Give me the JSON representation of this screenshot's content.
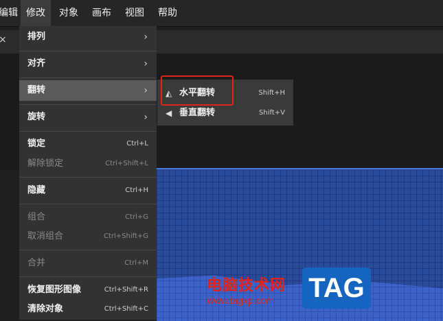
{
  "menubar": {
    "items": [
      "编辑",
      "修改",
      "对象",
      "画布",
      "视图",
      "帮助"
    ]
  },
  "tab": {
    "close_glyph": "×"
  },
  "dropdown": {
    "items": [
      {
        "label": "排列",
        "arrow": "›"
      },
      {
        "label": "对齐",
        "arrow": "›"
      },
      {
        "label": "翻转",
        "arrow": "›"
      },
      {
        "label": "旋转",
        "arrow": "›"
      },
      {
        "label": "锁定",
        "shortcut": "Ctrl+L"
      },
      {
        "label": "解除锁定",
        "shortcut": "Ctrl+Shift+L"
      },
      {
        "label": "隐藏",
        "shortcut": "Ctrl+H"
      },
      {
        "label": "组合",
        "shortcut": "Ctrl+G"
      },
      {
        "label": "取消组合",
        "shortcut": "Ctrl+Shift+G"
      },
      {
        "label": "合并",
        "shortcut": "Ctrl+M"
      },
      {
        "label": "恢复图形图像",
        "shortcut": "Ctrl+Shift+R"
      },
      {
        "label": "清除对象",
        "shortcut": "Ctrl+Shift+C"
      }
    ]
  },
  "submenu": {
    "items": [
      {
        "icon": "flip-horizontal-icon",
        "glyph": "◭",
        "label": "水平翻转",
        "shortcut": "Shift+H"
      },
      {
        "icon": "flip-vertical-icon",
        "glyph": "◀",
        "label": "垂直翻转",
        "shortcut": "Shift+V"
      }
    ]
  },
  "watermark": {
    "site_name": "电脑技术网",
    "url": "www.tagxp.com",
    "logo_text": "TAG"
  },
  "colors": {
    "highlight": "#e0241b",
    "canvas": "#2a4a9a"
  }
}
